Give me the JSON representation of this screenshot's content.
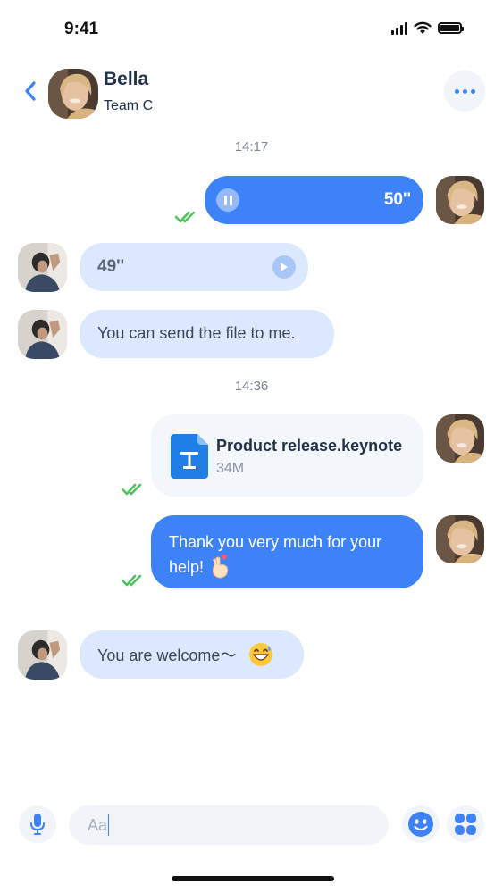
{
  "status_bar": {
    "time": "9:41"
  },
  "header": {
    "name": "Bella",
    "team": "Team C"
  },
  "timestamps": [
    "14:17",
    "14:36"
  ],
  "messages": {
    "voice_out": {
      "duration": "50''"
    },
    "voice_in": {
      "duration": "49''"
    },
    "text_in_1": "You can send the file to me.",
    "file_out": {
      "name": "Product release.keynote",
      "size": "34M"
    },
    "text_out_line1": "Thank you very much for your",
    "text_out_line2": "help!",
    "text_in_2": "You are welcome～"
  },
  "composer": {
    "placeholder": "Aa"
  },
  "colors": {
    "accent": "#3e82f7",
    "incoming_bubble": "#dce8fd",
    "read_check": "#4cc35c"
  }
}
